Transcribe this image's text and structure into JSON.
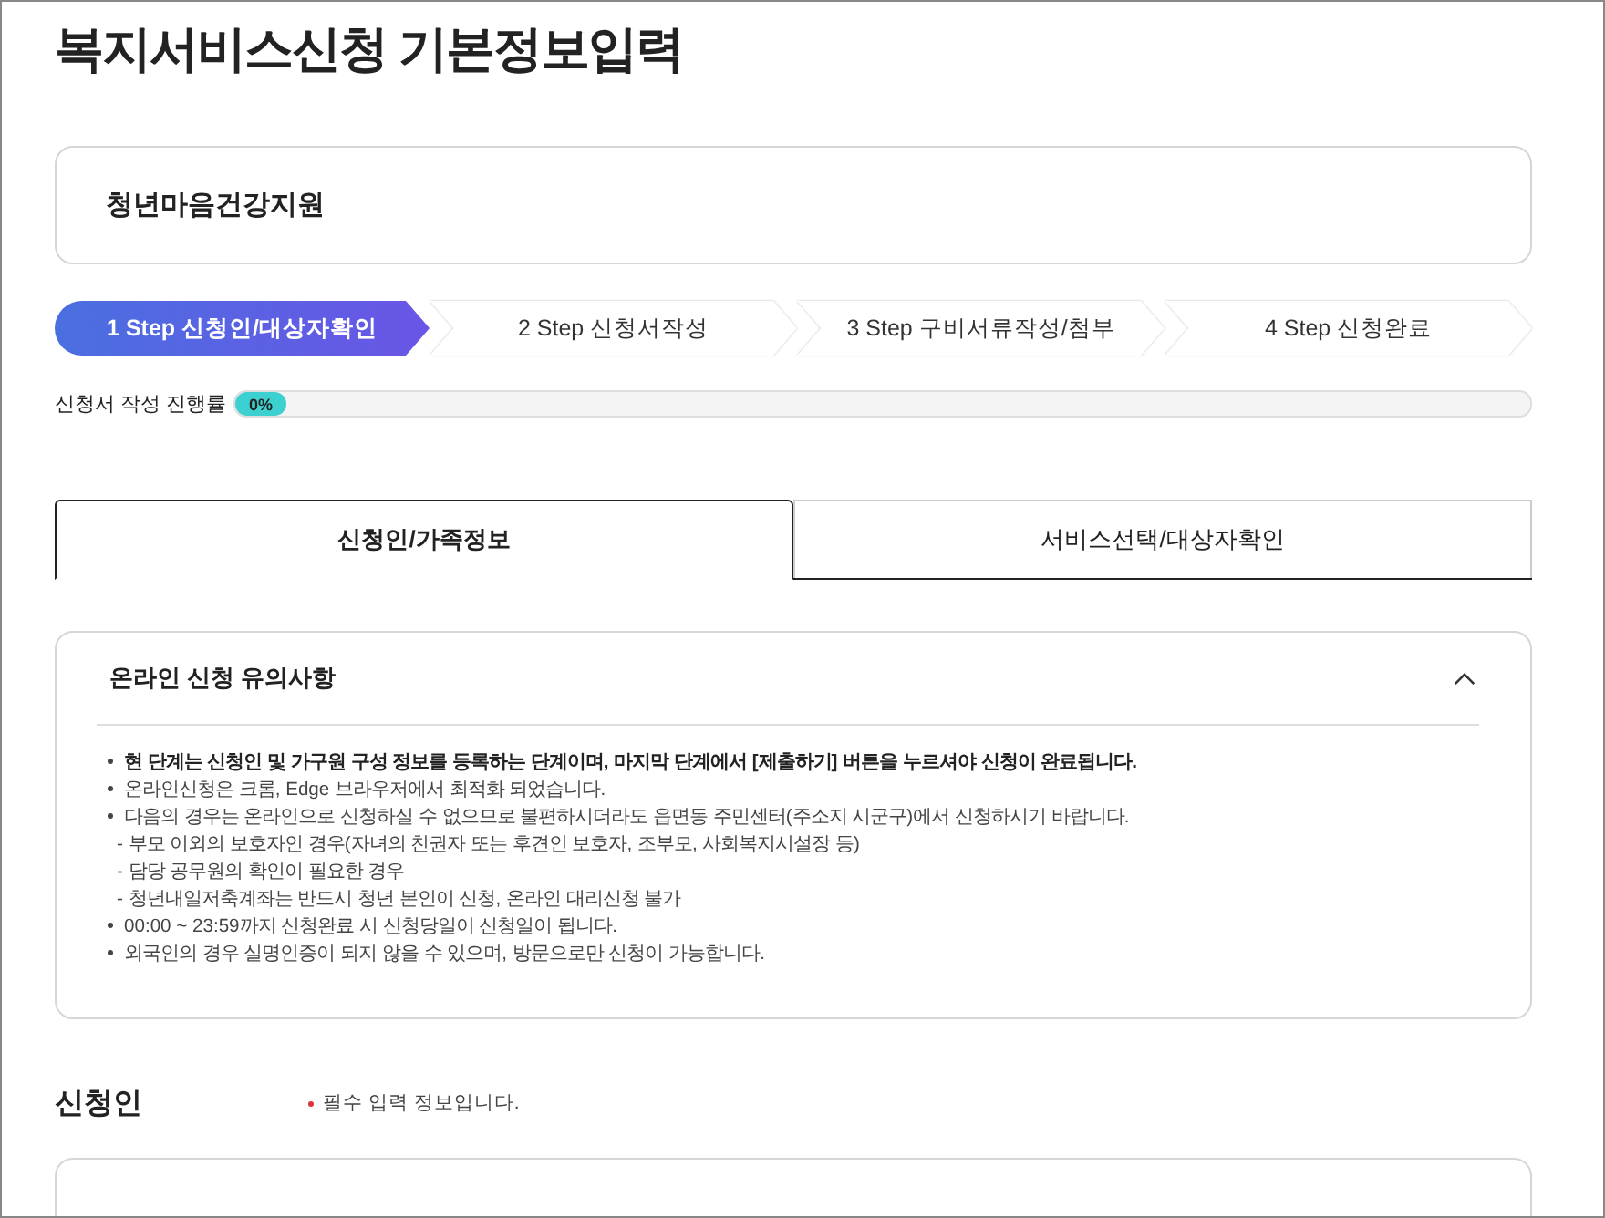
{
  "page_title": "복지서비스신청 기본정보입력",
  "service_name": "청년마음건강지원",
  "steps": [
    {
      "label": "1 Step 신청인/대상자확인",
      "selected": true
    },
    {
      "label": "2 Step 신청서작성",
      "selected": false
    },
    {
      "label": "3 Step 구비서류작성/첨부",
      "selected": false
    },
    {
      "label": "4 Step 신청완료",
      "selected": false
    }
  ],
  "progress": {
    "label": "신청서 작성 진행률",
    "level": 0,
    "reading": "0%"
  },
  "tabs": [
    {
      "label": "신청인/가족정보",
      "selected": true
    },
    {
      "label": "서비스선택/대상자확인",
      "selected": false
    }
  ],
  "notice": {
    "title": "온라인 신청 유의사항",
    "expanded": true,
    "items": [
      {
        "kind": "bullet",
        "bold": true,
        "text": "현 단계는 신청인 및 가구원 구성 정보를 등록하는 단계이며, 마지막 단계에서 [제출하기] 버튼을 누르셔야 신청이 완료됩니다."
      },
      {
        "kind": "bullet",
        "bold": false,
        "text": "온라인신청은 크롬, Edge 브라우저에서 최적화 되었습니다."
      },
      {
        "kind": "bullet",
        "bold": false,
        "text": "다음의 경우는 온라인으로 신청하실 수 없으므로 불편하시더라도 읍면동 주민센터(주소지 시군구)에서 신청하시기 바랍니다."
      },
      {
        "kind": "sub",
        "bold": false,
        "text": "- 부모 이외의 보호자인 경우(자녀의 친권자 또는 후견인 보호자, 조부모, 사회복지시설장 등)"
      },
      {
        "kind": "sub",
        "bold": false,
        "text": "- 담당 공무원의 확인이 필요한 경우"
      },
      {
        "kind": "sub",
        "bold": false,
        "text": "- 청년내일저축계좌는 반드시 청년 본인이 신청, 온라인 대리신청 불가"
      },
      {
        "kind": "bullet",
        "bold": false,
        "text": "00:00 ~ 23:59까지 신청완료 시 신청당일이 신청일이 됩니다."
      },
      {
        "kind": "bullet",
        "bold": false,
        "text": "외국인의 경우 실명인증이 되지 않을 수 있으며, 방문으로만 신청이 가능합니다."
      }
    ]
  },
  "applicant": {
    "title": "신청인",
    "required_note": "필수 입력 정보입니다."
  }
}
